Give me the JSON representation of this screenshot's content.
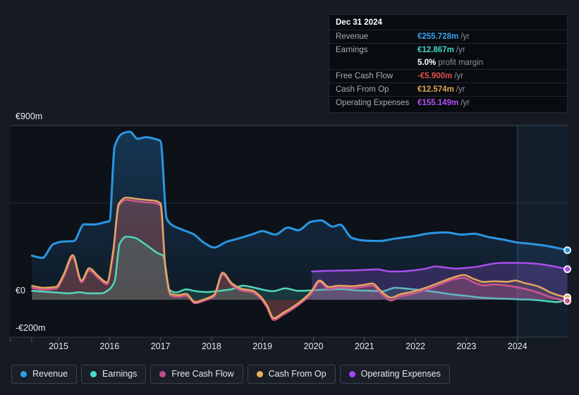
{
  "page": {
    "background": "#151a23"
  },
  "tooltip": {
    "title": "Dec 31 2024",
    "rows": [
      {
        "label": "Revenue",
        "value": "€255.728m",
        "unit": "/yr",
        "color": "#38a3f1"
      },
      {
        "label": "Earnings",
        "value": "€12.867m",
        "unit": "/yr",
        "color": "#41d9c6",
        "extra_value": "5.0%",
        "extra_label": "profit margin"
      },
      {
        "label": "Free Cash Flow",
        "value": "-€5.900m",
        "unit": "/yr",
        "color": "#e0504d"
      },
      {
        "label": "Cash From Op",
        "value": "€12.574m",
        "unit": "/yr",
        "color": "#e3a455"
      },
      {
        "label": "Operating Expenses",
        "value": "€155.149m",
        "unit": "/yr",
        "color": "#b44ff2"
      }
    ]
  },
  "legend": {
    "items": [
      {
        "label": "Revenue",
        "color": "#2e9ff0"
      },
      {
        "label": "Earnings",
        "color": "#3fe0c5"
      },
      {
        "label": "Free Cash Flow",
        "color": "#c2498a"
      },
      {
        "label": "Cash From Op",
        "color": "#e8b05c"
      },
      {
        "label": "Operating Expenses",
        "color": "#ad42f5"
      }
    ]
  },
  "chart_data": {
    "type": "area",
    "unit": "€m",
    "x_ticks": [
      "2015",
      "2016",
      "2017",
      "2018",
      "2019",
      "2020",
      "2021",
      "2022",
      "2023",
      "2024"
    ],
    "y_axis": {
      "labels": [
        {
          "text": "€900m",
          "value": 900
        },
        {
          "text": "€0",
          "value": 0
        },
        {
          "text": "-€200m",
          "value": -200
        }
      ],
      "unlabeled_gridline_value": 500
    },
    "highlight_from_year": 2024,
    "series": [
      {
        "name": "Revenue",
        "color": "#2b96e2",
        "fill": "gradient",
        "points": [
          [
            2014.48,
            228
          ],
          [
            2014.68,
            216
          ],
          [
            2014.9,
            288
          ],
          [
            2015.1,
            301
          ],
          [
            2015.3,
            303
          ],
          [
            2015.5,
            390
          ],
          [
            2015.7,
            389
          ],
          [
            2015.9,
            400
          ],
          [
            2016.0,
            407
          ],
          [
            2016.1,
            790
          ],
          [
            2016.25,
            858
          ],
          [
            2016.4,
            868
          ],
          [
            2016.55,
            832
          ],
          [
            2016.72,
            840
          ],
          [
            2016.9,
            830
          ],
          [
            2017.0,
            820
          ],
          [
            2017.12,
            420
          ],
          [
            2017.25,
            382
          ],
          [
            2017.45,
            360
          ],
          [
            2017.65,
            338
          ],
          [
            2017.85,
            295
          ],
          [
            2018.05,
            270
          ],
          [
            2018.3,
            300
          ],
          [
            2018.55,
            318
          ],
          [
            2018.8,
            338
          ],
          [
            2019.0,
            355
          ],
          [
            2019.25,
            337
          ],
          [
            2019.5,
            373
          ],
          [
            2019.7,
            359
          ],
          [
            2019.95,
            403
          ],
          [
            2020.15,
            410
          ],
          [
            2020.38,
            378
          ],
          [
            2020.52,
            388
          ],
          [
            2020.75,
            320
          ],
          [
            2021.0,
            306
          ],
          [
            2021.3,
            304
          ],
          [
            2021.6,
            316
          ],
          [
            2022.0,
            330
          ],
          [
            2022.3,
            344
          ],
          [
            2022.6,
            348
          ],
          [
            2022.9,
            337
          ],
          [
            2023.15,
            341
          ],
          [
            2023.45,
            323
          ],
          [
            2023.7,
            312
          ],
          [
            2024.0,
            296
          ],
          [
            2024.3,
            288
          ],
          [
            2024.6,
            277
          ],
          [
            2024.98,
            256
          ]
        ]
      },
      {
        "name": "Earnings",
        "color": "#52d7bb",
        "fill": "rgba(82,215,187,0.16)",
        "points": [
          [
            2014.48,
            46
          ],
          [
            2014.7,
            42
          ],
          [
            2014.95,
            38
          ],
          [
            2015.2,
            33
          ],
          [
            2015.4,
            39
          ],
          [
            2015.6,
            33
          ],
          [
            2015.85,
            34
          ],
          [
            2016.0,
            55
          ],
          [
            2016.1,
            95
          ],
          [
            2016.2,
            290
          ],
          [
            2016.33,
            326
          ],
          [
            2016.5,
            320
          ],
          [
            2016.65,
            296
          ],
          [
            2016.8,
            268
          ],
          [
            2016.95,
            240
          ],
          [
            2017.05,
            228
          ],
          [
            2017.18,
            50
          ],
          [
            2017.3,
            37
          ],
          [
            2017.5,
            54
          ],
          [
            2017.7,
            44
          ],
          [
            2017.9,
            40
          ],
          [
            2018.15,
            46
          ],
          [
            2018.4,
            55
          ],
          [
            2018.62,
            73
          ],
          [
            2018.85,
            62
          ],
          [
            2019.05,
            50
          ],
          [
            2019.2,
            44
          ],
          [
            2019.45,
            59
          ],
          [
            2019.7,
            46
          ],
          [
            2019.95,
            48
          ],
          [
            2020.25,
            53
          ],
          [
            2020.55,
            55
          ],
          [
            2020.85,
            48
          ],
          [
            2021.1,
            47
          ],
          [
            2021.35,
            44
          ],
          [
            2021.6,
            62
          ],
          [
            2021.85,
            57
          ],
          [
            2022.1,
            50
          ],
          [
            2022.4,
            40
          ],
          [
            2022.7,
            28
          ],
          [
            2023.0,
            20
          ],
          [
            2023.35,
            10
          ],
          [
            2023.7,
            6
          ],
          [
            2024.0,
            3
          ],
          [
            2024.3,
            0
          ],
          [
            2024.6,
            -8
          ],
          [
            2024.78,
            -12
          ],
          [
            2024.9,
            -5
          ],
          [
            2024.98,
            8
          ]
        ]
      },
      {
        "name": "Free Cash Flow",
        "color": "#cf5590",
        "fill": "rgba(205,75,130,0.22)",
        "points": [
          [
            2014.48,
            62
          ],
          [
            2014.7,
            52
          ],
          [
            2014.95,
            57
          ],
          [
            2015.1,
            118
          ],
          [
            2015.28,
            220
          ],
          [
            2015.45,
            90
          ],
          [
            2015.6,
            152
          ],
          [
            2015.78,
            112
          ],
          [
            2015.95,
            80
          ],
          [
            2016.07,
            238
          ],
          [
            2016.18,
            483
          ],
          [
            2016.33,
            516
          ],
          [
            2016.5,
            510
          ],
          [
            2016.7,
            504
          ],
          [
            2016.88,
            500
          ],
          [
            2017.0,
            486
          ],
          [
            2017.1,
            150
          ],
          [
            2017.2,
            21
          ],
          [
            2017.35,
            15
          ],
          [
            2017.5,
            22
          ],
          [
            2017.68,
            -18
          ],
          [
            2017.85,
            -5
          ],
          [
            2018.05,
            16
          ],
          [
            2018.22,
            130
          ],
          [
            2018.4,
            76
          ],
          [
            2018.6,
            47
          ],
          [
            2018.8,
            39
          ],
          [
            2018.95,
            10
          ],
          [
            2019.08,
            -36
          ],
          [
            2019.22,
            -105
          ],
          [
            2019.4,
            -78
          ],
          [
            2019.55,
            -55
          ],
          [
            2019.75,
            -18
          ],
          [
            2019.95,
            28
          ],
          [
            2020.12,
            92
          ],
          [
            2020.3,
            56
          ],
          [
            2020.5,
            63
          ],
          [
            2020.75,
            60
          ],
          [
            2021.0,
            68
          ],
          [
            2021.15,
            73
          ],
          [
            2021.35,
            26
          ],
          [
            2021.52,
            -4
          ],
          [
            2021.7,
            17
          ],
          [
            2021.95,
            31
          ],
          [
            2022.2,
            51
          ],
          [
            2022.5,
            81
          ],
          [
            2022.75,
            106
          ],
          [
            2022.95,
            113
          ],
          [
            2023.15,
            89
          ],
          [
            2023.35,
            74
          ],
          [
            2023.55,
            79
          ],
          [
            2023.8,
            73
          ],
          [
            2023.95,
            67
          ],
          [
            2024.15,
            56
          ],
          [
            2024.4,
            38
          ],
          [
            2024.65,
            14
          ],
          [
            2024.85,
            0
          ],
          [
            2024.98,
            -5.9
          ]
        ]
      },
      {
        "name": "Cash From Op",
        "color": "#e5a75f",
        "fill": "rgba(229,167,95,0.14)",
        "points": [
          [
            2014.48,
            72
          ],
          [
            2014.7,
            62
          ],
          [
            2014.95,
            67
          ],
          [
            2015.1,
            130
          ],
          [
            2015.28,
            231
          ],
          [
            2015.45,
            100
          ],
          [
            2015.6,
            163
          ],
          [
            2015.78,
            122
          ],
          [
            2015.95,
            90
          ],
          [
            2016.07,
            250
          ],
          [
            2016.18,
            495
          ],
          [
            2016.33,
            528
          ],
          [
            2016.5,
            522
          ],
          [
            2016.7,
            516
          ],
          [
            2016.88,
            512
          ],
          [
            2017.0,
            498
          ],
          [
            2017.1,
            160
          ],
          [
            2017.2,
            30
          ],
          [
            2017.35,
            24
          ],
          [
            2017.5,
            31
          ],
          [
            2017.68,
            -12
          ],
          [
            2017.85,
            2
          ],
          [
            2018.05,
            25
          ],
          [
            2018.22,
            140
          ],
          [
            2018.4,
            85
          ],
          [
            2018.6,
            56
          ],
          [
            2018.8,
            48
          ],
          [
            2018.95,
            20
          ],
          [
            2019.08,
            -25
          ],
          [
            2019.22,
            -95
          ],
          [
            2019.4,
            -68
          ],
          [
            2019.55,
            -45
          ],
          [
            2019.75,
            -8
          ],
          [
            2019.95,
            40
          ],
          [
            2020.12,
            100
          ],
          [
            2020.3,
            66
          ],
          [
            2020.5,
            73
          ],
          [
            2020.75,
            70
          ],
          [
            2021.0,
            78
          ],
          [
            2021.15,
            84
          ],
          [
            2021.35,
            38
          ],
          [
            2021.52,
            11
          ],
          [
            2021.7,
            28
          ],
          [
            2021.95,
            42
          ],
          [
            2022.2,
            62
          ],
          [
            2022.5,
            92
          ],
          [
            2022.75,
            116
          ],
          [
            2022.95,
            128
          ],
          [
            2023.15,
            107
          ],
          [
            2023.35,
            92
          ],
          [
            2023.55,
            96
          ],
          [
            2023.8,
            93
          ],
          [
            2023.95,
            99
          ],
          [
            2024.15,
            86
          ],
          [
            2024.4,
            70
          ],
          [
            2024.65,
            38
          ],
          [
            2024.85,
            20
          ],
          [
            2024.98,
            12.6
          ]
        ]
      },
      {
        "name": "Operating Expenses",
        "color": "#a94ded",
        "fill": "rgba(150,85,220,0.26)",
        "points": [
          [
            2019.97,
            146
          ],
          [
            2020.2,
            149
          ],
          [
            2020.5,
            151
          ],
          [
            2020.8,
            152
          ],
          [
            2021.05,
            155
          ],
          [
            2021.25,
            157
          ],
          [
            2021.5,
            146
          ],
          [
            2021.75,
            147
          ],
          [
            2022.0,
            153
          ],
          [
            2022.2,
            161
          ],
          [
            2022.4,
            172
          ],
          [
            2022.6,
            166
          ],
          [
            2022.8,
            161
          ],
          [
            2023.0,
            165
          ],
          [
            2023.2,
            170
          ],
          [
            2023.4,
            181
          ],
          [
            2023.6,
            189
          ],
          [
            2023.85,
            191
          ],
          [
            2024.1,
            190
          ],
          [
            2024.35,
            187
          ],
          [
            2024.6,
            178
          ],
          [
            2024.8,
            168
          ],
          [
            2024.98,
            158
          ]
        ]
      }
    ]
  }
}
